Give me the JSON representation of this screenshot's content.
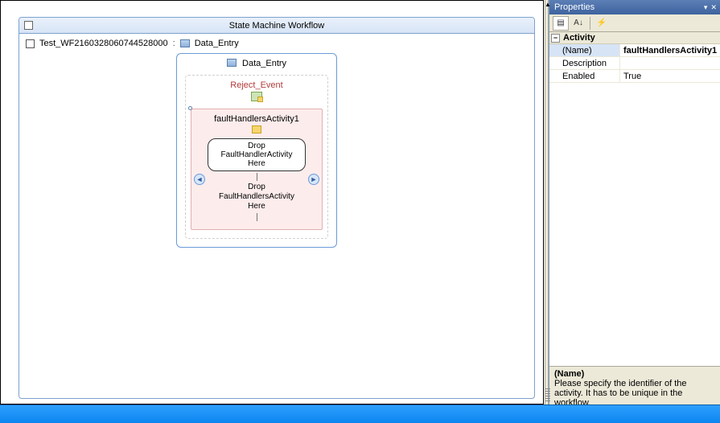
{
  "canvas": {
    "title": "State Machine Workflow",
    "breadcrumb": {
      "workflow_name": "Test_WF2160328060744528000",
      "separator": ":",
      "state_name": "Data_Entry"
    }
  },
  "state": {
    "title": "Data_Entry",
    "event": {
      "name": "Reject_Event",
      "fault_activity_name": "faultHandlersActivity1",
      "drop_capsule_text": "Drop FaultHandlerActivity Here",
      "drop_inline_text": "Drop FaultHandlersActivity Here"
    }
  },
  "props": {
    "panel_title": "Properties",
    "category": "Activity",
    "rows": [
      {
        "name": "(Name)",
        "value": "faultHandlersActivity1"
      },
      {
        "name": "Description",
        "value": ""
      },
      {
        "name": "Enabled",
        "value": "True"
      }
    ],
    "desc_title": "(Name)",
    "desc_text": "Please specify the identifier of the activity. It has to be unique in the workflow."
  }
}
